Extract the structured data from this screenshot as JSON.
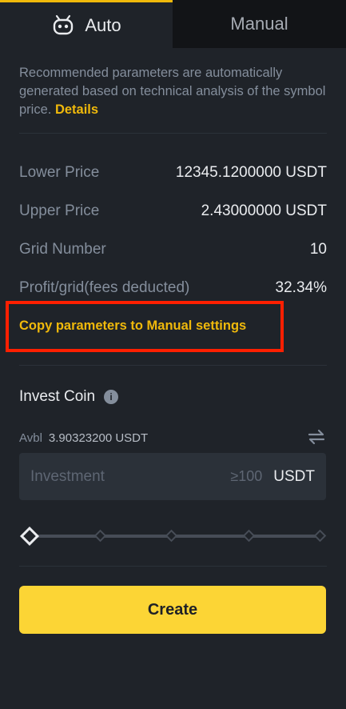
{
  "tabs": {
    "auto_label": "Auto",
    "manual_label": "Manual"
  },
  "description": {
    "text": "Recommended parameters are automatically generated based on technical analysis of the symbol price.",
    "link": "Details"
  },
  "params": [
    {
      "label": "Lower Price",
      "value": "12345.1200000 USDT"
    },
    {
      "label": "Upper Price",
      "value": "2.43000000 USDT"
    },
    {
      "label": "Grid Number",
      "value": "10"
    },
    {
      "label": "Profit/grid(fees deducted)",
      "value": "32.34%"
    }
  ],
  "copy_link": "Copy parameters to Manual settings",
  "invest": {
    "title": "Invest Coin",
    "avbl_label": "Avbl",
    "avbl_value": "3.90323200 USDT",
    "placeholder": "Investment",
    "min": "≥100",
    "unit": "USDT"
  },
  "slider": {
    "value_percent": 0
  },
  "create_label": "Create",
  "colors": {
    "accent": "#f0b90b",
    "button": "#fcd535",
    "highlight": "#ff1f00",
    "bg": "#1f2329"
  }
}
